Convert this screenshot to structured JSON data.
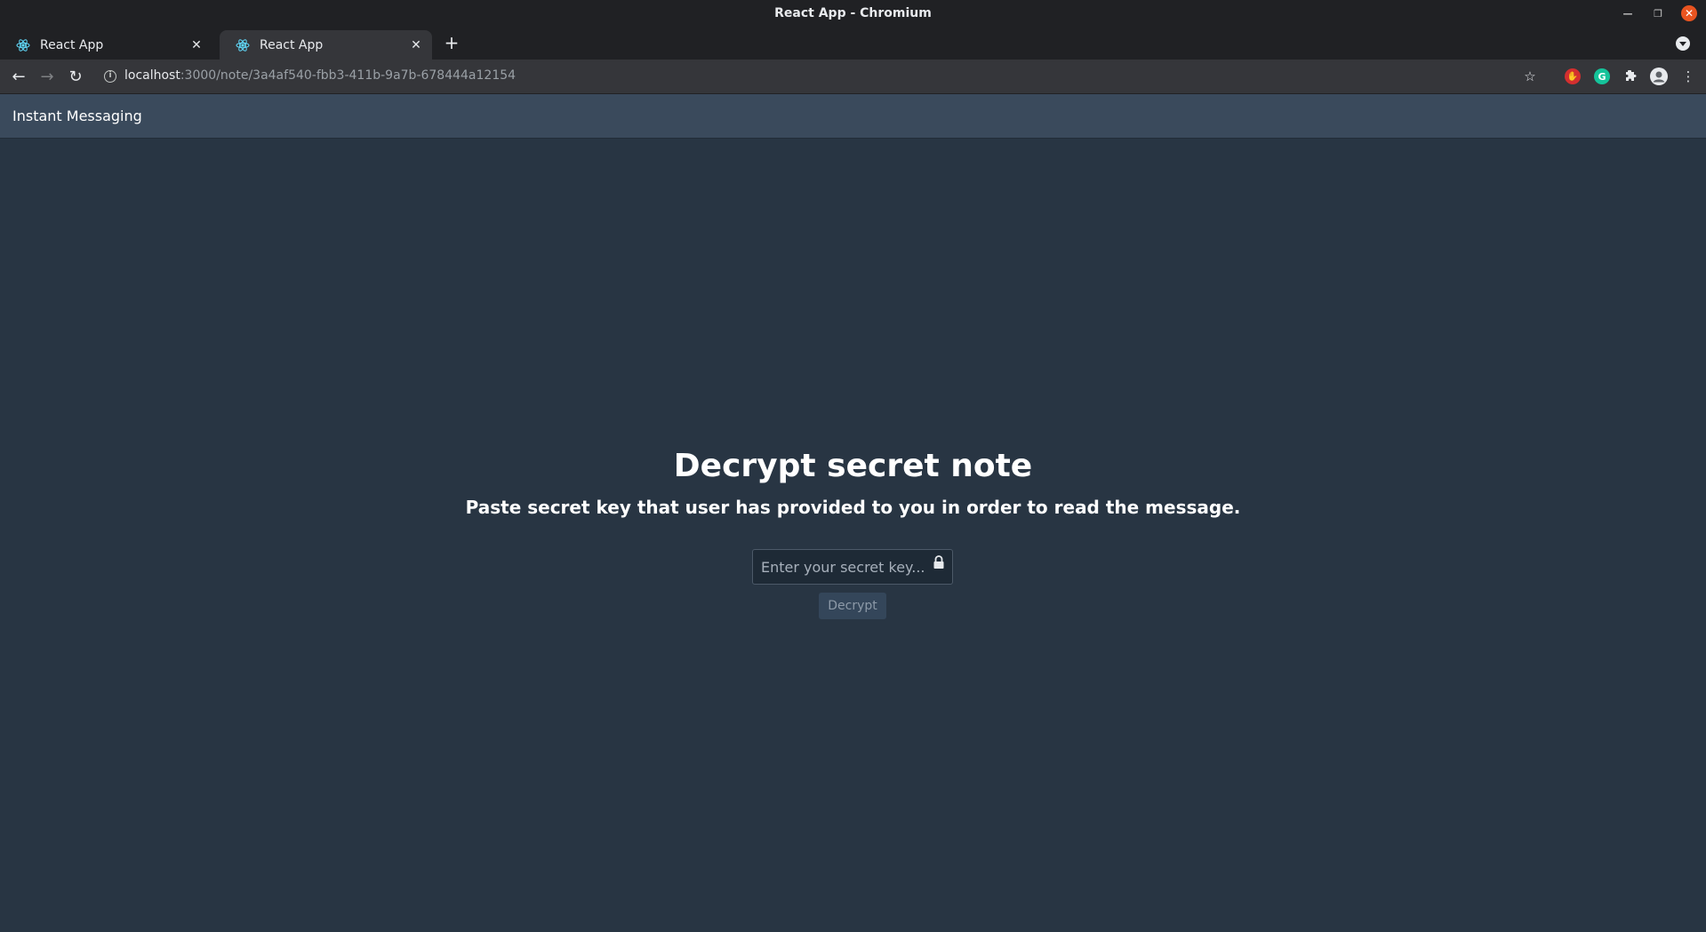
{
  "window": {
    "title": "React App - Chromium"
  },
  "tabs": [
    {
      "label": "React App",
      "active": false
    },
    {
      "label": "React App",
      "active": true
    }
  ],
  "address_bar": {
    "host": "localhost",
    "rest": ":3000/note/3a4af540-fbb3-411b-9a7b-678444a12154"
  },
  "app": {
    "brand": "Instant Messaging",
    "heading": "Decrypt secret note",
    "subheading": "Paste secret key that user has provided to you in order to read the message.",
    "key_input": {
      "placeholder": "Enter your secret key...",
      "value": ""
    },
    "decrypt_label": "Decrypt"
  },
  "colors": {
    "background": "#283543",
    "header": "#3a4a5c",
    "close_button": "#e95420"
  }
}
